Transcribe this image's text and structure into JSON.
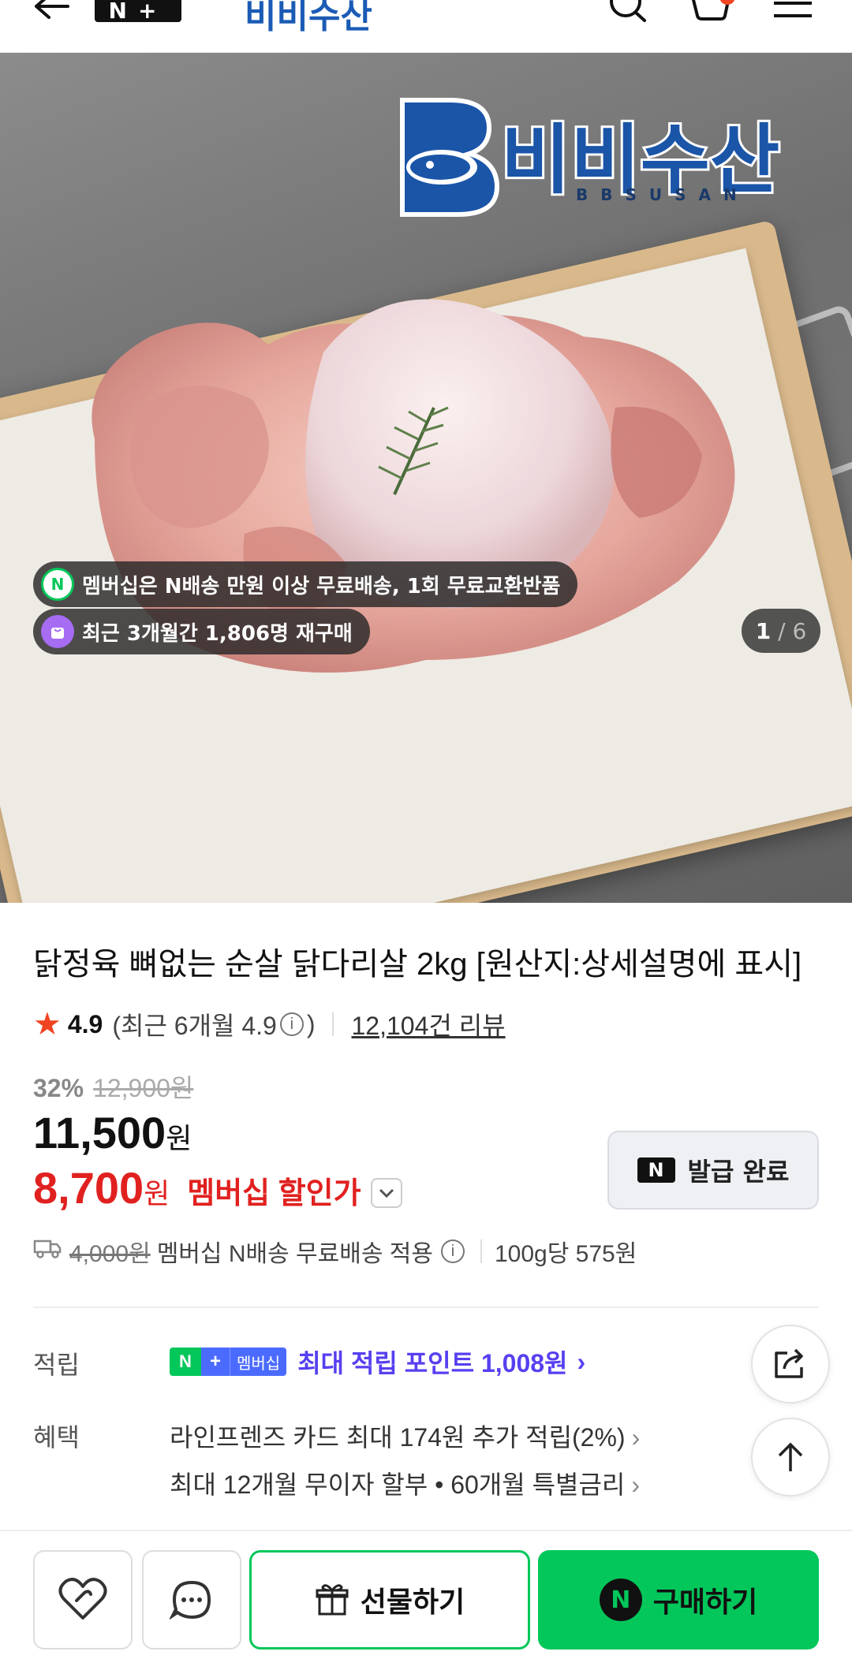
{
  "header": {
    "brand_badge": "N+",
    "store_name": "비비수산"
  },
  "hero": {
    "logo_text": "비비수산",
    "logo_sub": "BBSUSAN",
    "membership_pill": "멤버십은 N배송 만원 이상 무료배송, 1회 무료교환반품",
    "membership_pill_icon": "N",
    "repurchase_pill": "최근 3개월간 1,806명 재구매",
    "counter_current": "1",
    "counter_total": "6"
  },
  "product": {
    "title": "닭정육 뼈없는 순살 닭다리살 2kg [원산지:상세설명에 표시]",
    "rating": "4.9",
    "rating_recent": "(최근 6개월 4.9",
    "rating_close": ")",
    "review_count": "12,104건 리뷰",
    "discount_rate": "32%",
    "original_price": "12,900원",
    "price": "11,500",
    "price_unit": "원",
    "member_price": "8,700",
    "member_price_unit": "원",
    "member_price_label": "멤버십 할인가",
    "coupon_badge": "N",
    "coupon_label": "발급 완료"
  },
  "shipping": {
    "fee_struck": "4,000원",
    "text": "멤버십 N배송 무료배송 적용",
    "unit_price": "100g당 575원"
  },
  "points": {
    "label": "적립",
    "badge_n": "N",
    "badge_plus": "+",
    "badge_membership": "멤버십",
    "text": "최대 적립 포인트 1,008원",
    "chevron": "›"
  },
  "benefits": {
    "label": "혜택",
    "items": [
      {
        "text": "라인프렌즈 카드 최대 174원 추가 적립(2%)",
        "chevron": "›"
      },
      {
        "text": "최대 12개월 무이자 할부 • 60개월 특별금리",
        "chevron": "›"
      }
    ]
  },
  "bottom_bar": {
    "gift_label": "선물하기",
    "buy_label": "구매하기",
    "buy_badge": "N"
  },
  "colors": {
    "naver_green": "#03c75a",
    "sale_red": "#e0211f",
    "point_purple": "#5640f0",
    "brand_blue": "#1a55a8"
  }
}
